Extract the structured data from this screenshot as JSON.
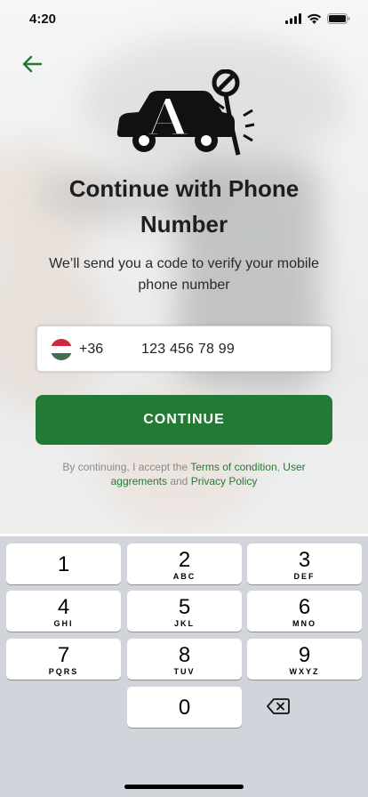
{
  "status_bar": {
    "time": "4:20",
    "icons": [
      "signal-icon",
      "wifi-icon",
      "battery-icon"
    ]
  },
  "header": {
    "back_icon": "arrow-left-icon"
  },
  "logo": {
    "letter": "A"
  },
  "main": {
    "title": "Continue with Phone Number",
    "subtitle": "We’ll send you a code to verify your mobile phone number"
  },
  "phone_input": {
    "flag": "hungary-flag-icon",
    "country_code": "+36",
    "number": "123 456 78 99"
  },
  "cta": {
    "label": "CONTINUE"
  },
  "legal": {
    "prefix": "By continuing, I accept the ",
    "terms": "Terms of condition",
    "comma": ", ",
    "user_agreements": "User aggrements",
    "and": " and ",
    "privacy": "Privacy Policy"
  },
  "keyboard": {
    "keys": [
      {
        "digit": "1",
        "letters": ""
      },
      {
        "digit": "2",
        "letters": "ABC"
      },
      {
        "digit": "3",
        "letters": "DEF"
      },
      {
        "digit": "4",
        "letters": "GHI"
      },
      {
        "digit": "5",
        "letters": "JKL"
      },
      {
        "digit": "6",
        "letters": "MNO"
      },
      {
        "digit": "7",
        "letters": "PQRS"
      },
      {
        "digit": "8",
        "letters": "TUV"
      },
      {
        "digit": "9",
        "letters": "WXYZ"
      },
      {
        "digit": "0",
        "letters": ""
      }
    ],
    "delete_icon": "backspace-icon"
  },
  "colors": {
    "accent": "#237a35",
    "keyboard_bg": "#d1d4da"
  }
}
